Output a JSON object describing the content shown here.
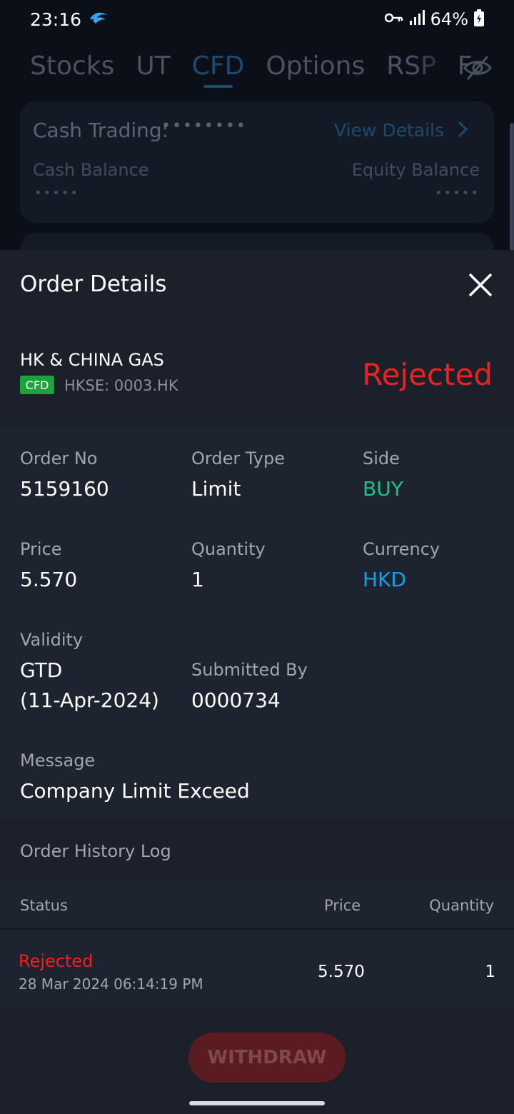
{
  "status_bar": {
    "time": "23:16",
    "battery": "64%"
  },
  "tabs": [
    "Stocks",
    "UT",
    "CFD",
    "Options",
    "RSP",
    "F"
  ],
  "account_card": {
    "cash_trading_label": "Cash Trading:",
    "cash_trading_mask": "••••••••",
    "view_details": "View Details",
    "cash_balance_label": "Cash Balance",
    "cash_balance_mask": "•••••",
    "equity_balance_label": "Equity Balance",
    "equity_balance_mask": "•••••"
  },
  "sheet": {
    "title": "Order Details",
    "instrument": {
      "name": "HK & CHINA GAS",
      "badge": "CFD",
      "code": "HKSE: 0003.HK"
    },
    "status": "Rejected",
    "fields": {
      "order_no": {
        "label": "Order No",
        "value": "5159160"
      },
      "order_type": {
        "label": "Order Type",
        "value": "Limit"
      },
      "side": {
        "label": "Side",
        "value": "BUY"
      },
      "price": {
        "label": "Price",
        "value": "5.570"
      },
      "quantity": {
        "label": "Quantity",
        "value": "1"
      },
      "currency": {
        "label": "Currency",
        "value": "HKD"
      },
      "validity": {
        "label": "Validity",
        "value_line1": "GTD",
        "value_line2": "(11-Apr-2024)"
      },
      "submitted_by": {
        "label": "Submitted By",
        "value": "0000734"
      },
      "message": {
        "label": "Message",
        "value": "Company Limit Exceed"
      }
    },
    "history": {
      "title": "Order History Log",
      "headers": {
        "status": "Status",
        "price": "Price",
        "quantity": "Quantity"
      },
      "rows": [
        {
          "status": "Rejected",
          "time": "28 Mar 2024 06:14:19 PM",
          "price": "5.570",
          "quantity": "1"
        }
      ]
    },
    "withdraw_label": "WITHDRAW"
  },
  "colors": {
    "rejected": "#ee2020",
    "buy": "#1fc08a",
    "currency": "#1aa0e0",
    "cfd_badge": "#1ea33b"
  }
}
